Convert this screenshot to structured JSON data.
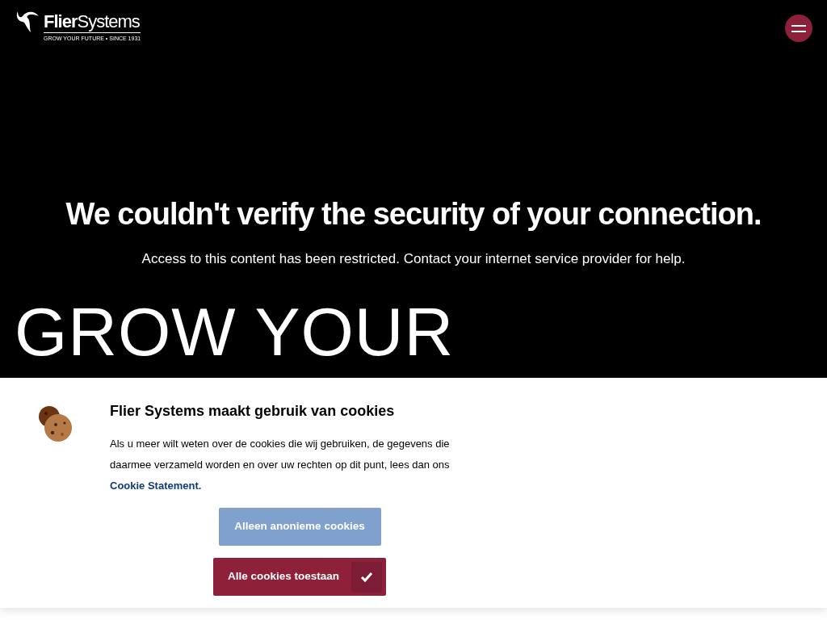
{
  "header": {
    "logo": {
      "name_bold": "Flier",
      "name_light": "Systems",
      "tagline": "GROW YOUR FUTURE • SINCE 1931"
    }
  },
  "security_notice": {
    "title": "We couldn't verify the security of your connection.",
    "message": "Access to this content has been restricted. Contact your internet service provider for help."
  },
  "hero": {
    "headline": "GROW YOUR"
  },
  "cookie_banner": {
    "title": "Flier Systems maakt gebruik van cookies",
    "text": "Als u meer wilt weten over de cookies die wij gebruiken, de gegevens die daarmee verzameld worden en over uw rechten op dit punt, lees dan ons ",
    "link": "Cookie Statement.",
    "buttons": [
      {
        "label": "Alleen anonieme cookies",
        "kind": "secondary"
      },
      {
        "label": "Alle cookies toestaan",
        "kind": "primary"
      }
    ]
  }
}
